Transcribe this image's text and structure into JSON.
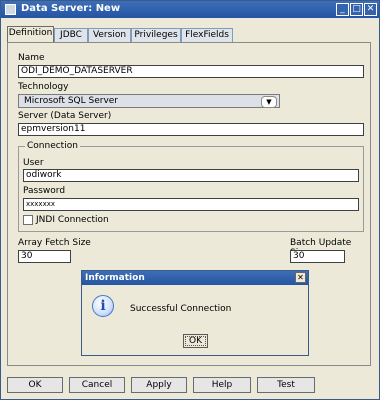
{
  "window": {
    "title": "Data Server: New"
  },
  "tabs": [
    "Definition",
    "JDBC",
    "Version",
    "Privileges",
    "FlexFields"
  ],
  "form": {
    "name_label": "Name",
    "name_value": "ODI_DEMO_DATASERVER",
    "technology_label": "Technology",
    "technology_value": "Microsoft SQL Server",
    "server_label": "Server (Data Server)",
    "server_value": "epmversion11",
    "connection_legend": "Connection",
    "user_label": "User",
    "user_value": "odiwork",
    "password_label": "Password",
    "password_value": "xxxxxxx",
    "jndi_label": "JNDI Connection",
    "array_fetch_label": "Array Fetch Size",
    "array_fetch_value": "30",
    "batch_update_label": "Batch Update Size",
    "batch_update_value": "30"
  },
  "dialog": {
    "title": "Information",
    "message": "Successful Connection",
    "ok_label": "OK"
  },
  "buttons": {
    "ok": "OK",
    "cancel": "Cancel",
    "apply": "Apply",
    "help": "Help",
    "test": "Test"
  },
  "colors": {
    "titlebar": "#2f5fae",
    "panel": "#ece9d8"
  }
}
